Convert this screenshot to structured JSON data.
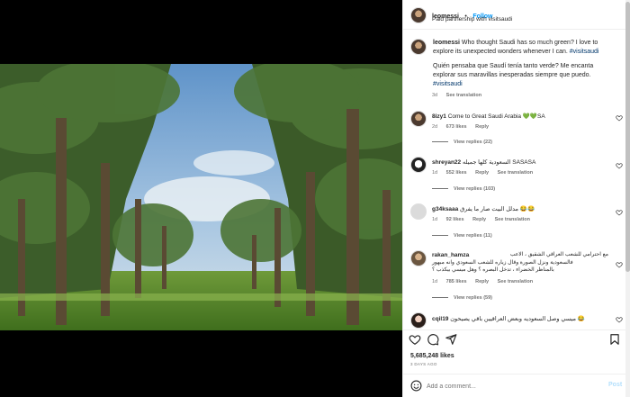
{
  "post": {
    "author": "leomessi",
    "follow_label": "Follow",
    "separator": "•",
    "partnership": "Paid partnership with visitsaudi"
  },
  "caption": {
    "author": "leomessi",
    "text_en_a": "Who thought Saudi has so much green? I love to",
    "text_en_b": "explore its unexpected wonders whenever I can.",
    "tag_en": "#visitsaudi",
    "text_es_a": "Quién pensaba que Saudí tenía tanto verde? Me encanta",
    "text_es_b": "explorar sus maravillas inesperadas siempre que puedo.",
    "tag_es": "#visitsaudi",
    "time": "3d",
    "see_translation": "See translation"
  },
  "comments": [
    {
      "user": "8izy1",
      "text": "Come to Great Saudi Arabia 💚💚SA",
      "time": "2d",
      "likes": "673 likes",
      "reply": "Reply",
      "see_translation": "",
      "view_replies": "View replies (22)"
    },
    {
      "user": "shreyan22",
      "text": "السعودية كلها جميله SASASA",
      "time": "1d",
      "likes": "552 likes",
      "reply": "Reply",
      "see_translation": "See translation",
      "view_replies": "View replies (103)"
    },
    {
      "user": "g34ksaaa",
      "text": "مدلل البيت صار ما يفرق 😂😂",
      "time": "1d",
      "likes": "92 likes",
      "reply": "Reply",
      "see_translation": "See translation",
      "view_replies": "View replies (11)"
    },
    {
      "user": "rakan_hamza",
      "text_a": "مع احترامي للشعب العراقي الشقيق ، الاعب",
      "text_b": "فالسعودية ونزل الصورة وقال زياره للشعب السعودي وانه مبهور",
      "text_c": "بالمناظر الخضراء ، تدخل البصره ؟ وهل ميسي بيكذب ؟",
      "time": "1d",
      "likes": "785 likes",
      "reply": "Reply",
      "see_translation": "See translation",
      "view_replies": "View replies (59)"
    },
    {
      "user": "cqil19",
      "text": "ميسي وصل السعوديه وبعض العراقيين باقي يصيحون 😂"
    }
  ],
  "actions": {
    "likes": "5,685,248 likes",
    "ago": "3 DAYS AGO"
  },
  "add_comment": {
    "placeholder": "Add a comment...",
    "post_label": "Post"
  },
  "colors": {
    "accent": "#0095f6",
    "link": "#00376b",
    "muted": "#737373"
  }
}
